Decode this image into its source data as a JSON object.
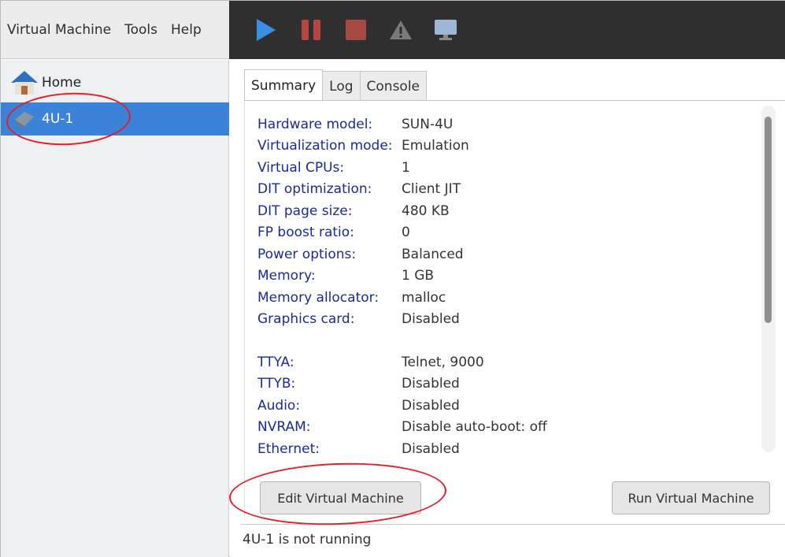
{
  "menu": {
    "items": [
      "Virtual Machine",
      "Tools",
      "Help"
    ]
  },
  "toolbar": {
    "buttons": [
      {
        "icon": "play-icon",
        "color": "#3a8ee6"
      },
      {
        "icon": "pause-icon",
        "color": "#b5463f"
      },
      {
        "icon": "stop-icon",
        "color": "#a84a44"
      },
      {
        "icon": "warning-icon",
        "color": "#7a7a7a"
      },
      {
        "icon": "monitor-icon",
        "color": "#9db8d6"
      }
    ],
    "background": "#2f2f2f"
  },
  "sidebar": {
    "home_label": "Home",
    "home_icon": "home-icon",
    "vm_label": "4U-1",
    "vm_icon": "machine-icon",
    "selected_color": "#3a83d8"
  },
  "tabs": [
    "Summary",
    "Log",
    "Console"
  ],
  "active_tab": "Summary",
  "details": [
    {
      "key": "Hardware model:",
      "value": "SUN-4U"
    },
    {
      "key": "Virtualization mode:",
      "value": "Emulation"
    },
    {
      "key": "Virtual CPUs:",
      "value": "1"
    },
    {
      "key": "DIT optimization:",
      "value": "Client JIT"
    },
    {
      "key": "DIT page size:",
      "value": "480 KB"
    },
    {
      "key": "FP boost ratio:",
      "value": "0"
    },
    {
      "key": "Power options:",
      "value": "Balanced"
    },
    {
      "key": "Memory:",
      "value": "1 GB"
    },
    {
      "key": "Memory allocator:",
      "value": "malloc"
    },
    {
      "key": "Graphics card:",
      "value": "Disabled"
    }
  ],
  "ports": [
    {
      "key": "TTYA:",
      "value": "Telnet, 9000"
    },
    {
      "key": "TTYB:",
      "value": "Disabled"
    },
    {
      "key": "Audio:",
      "value": "Disabled"
    },
    {
      "key": "NVRAM:",
      "value": "Disable auto-boot: off"
    },
    {
      "key": "Ethernet:",
      "value": "Disabled"
    }
  ],
  "buttons": {
    "edit": "Edit Virtual Machine",
    "run": "Run Virtual Machine"
  },
  "status": "4U-1 is not running",
  "colors": {
    "key_text": "#1d2a96",
    "annotation": "#e0202a"
  }
}
